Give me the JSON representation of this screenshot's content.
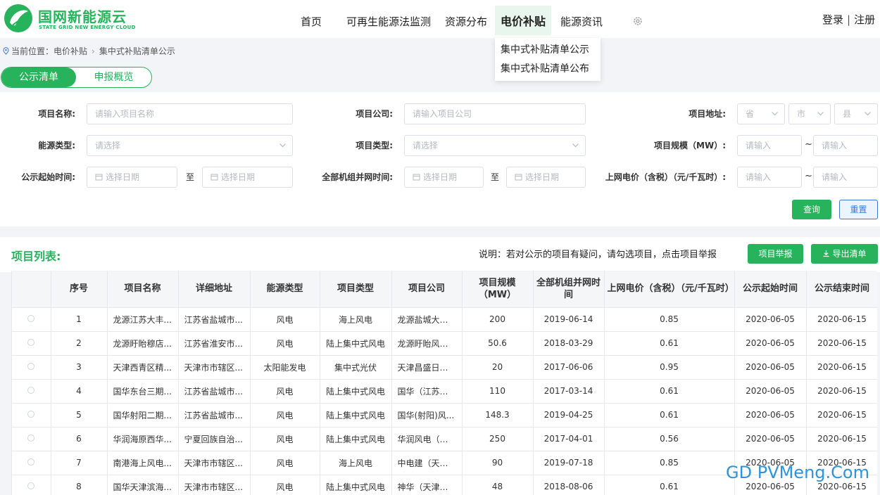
{
  "brand": {
    "name": "国网新能源云",
    "sub": "STATE GRID NEW ENERGY CLOUD",
    "color": "#27b35c"
  },
  "nav": {
    "items": [
      "首页",
      "可再生能源法监测",
      "资源分布",
      "电价补贴",
      "能源资讯"
    ],
    "active": "电价补贴",
    "settings_icon": "gear-icon"
  },
  "auth": {
    "login": "登录",
    "sep": "|",
    "register": "注册"
  },
  "dropdown": {
    "items": [
      "集中式补贴清单公示",
      "集中式补贴清单公布"
    ]
  },
  "breadcrumb": {
    "prefix": "当前位置：",
    "level1": "电价补贴",
    "level2": "集中式补贴清单公示"
  },
  "tabs": {
    "active": "公示清单",
    "other": "申报概览"
  },
  "filters": {
    "project_name": {
      "label": "项目名称:",
      "placeholder": "请输入项目名称"
    },
    "project_company": {
      "label": "项目公司:",
      "placeholder": "请输入项目公司"
    },
    "project_address": {
      "label": "项目地址:",
      "province": "省",
      "city": "市",
      "county": "县"
    },
    "energy_type": {
      "label": "能源类型:",
      "placeholder": "请选择"
    },
    "project_type": {
      "label": "项目类型:",
      "placeholder": "请选择"
    },
    "project_scale": {
      "label": "项目规模（MW）:",
      "min": "请输入",
      "max": "请输入"
    },
    "publicity_start": {
      "label": "公示起始时间:",
      "from": "选择日期",
      "to": "选择日期",
      "sep": "至"
    },
    "grid_time": {
      "label": "全部机组并网时间:",
      "from": "选择日期",
      "to": "选择日期",
      "sep": "至"
    },
    "price": {
      "label": "上网电价（含税）（元/千瓦时）:",
      "min": "请输入",
      "max": "请输入"
    },
    "range_sep": "~",
    "query_button": "查询",
    "reset_button": "重置"
  },
  "list": {
    "title": "项目列表:",
    "note": "说明：若对公示的项目有疑问，请勾选项目，点击项目举报",
    "report_button": "项目举报",
    "export_button": "导出清单"
  },
  "table": {
    "headers": [
      "",
      "序号",
      "项目名称",
      "详细地址",
      "能源类型",
      "项目类型",
      "项目公司",
      "项目规模（MW）",
      "全部机组并网时间",
      "上网电价（含税）（元/千瓦时）",
      "公示起始时间",
      "公示结束时间"
    ],
    "rows": [
      [
        "1",
        "龙源江苏大丰...",
        "江苏省盐城市...",
        "风电",
        "海上风电",
        "龙源盐城大丰...",
        "200",
        "2019-06-14",
        "0.85",
        "2020-06-05",
        "2020-06-15"
      ],
      [
        "2",
        "龙源盱眙穆店...",
        "江苏省淮安市...",
        "风电",
        "陆上集中式风电",
        "龙源盱眙风力...",
        "50.6",
        "2018-03-29",
        "0.61",
        "2020-06-05",
        "2020-06-15"
      ],
      [
        "3",
        "天津西青区精...",
        "天津市市辖区...",
        "太阳能发电",
        "集中式光伏",
        "天津昌盛日电...",
        "20",
        "2017-06-06",
        "0.95",
        "2020-06-05",
        "2020-06-15"
      ],
      [
        "4",
        "国华东台三期...",
        "江苏省盐城市...",
        "风电",
        "陆上集中式风电",
        "国华（江苏）...",
        "110",
        "2017-03-14",
        "0.61",
        "2020-06-05",
        "2020-06-15"
      ],
      [
        "5",
        "国华射阳二期...",
        "江苏省盐城市...",
        "风电",
        "陆上集中式风电",
        "国华(射阳)风...",
        "148.3",
        "2019-04-25",
        "0.61",
        "2020-06-05",
        "2020-06-15"
      ],
      [
        "6",
        "华润海原西华...",
        "宁夏回族自治...",
        "风电",
        "陆上集中式风电",
        "华润风电（海...",
        "250",
        "2017-04-01",
        "0.56",
        "2020-06-05",
        "2020-06-15"
      ],
      [
        "7",
        "南港海上风电...",
        "天津市市辖区...",
        "风电",
        "海上风电",
        "中电建（天津...",
        "90",
        "2019-07-18",
        "0.85",
        "2020-06-05",
        "2020-06-15"
      ],
      [
        "8",
        "国华天津滨海...",
        "天津市市辖区...",
        "风电",
        "陆上集中式风电",
        "神华（天津）...",
        "48",
        "2018-08-06",
        "0.61",
        "2020-06-05",
        "2020-06-15"
      ]
    ]
  },
  "watermark": "GD PVMeng.Com"
}
